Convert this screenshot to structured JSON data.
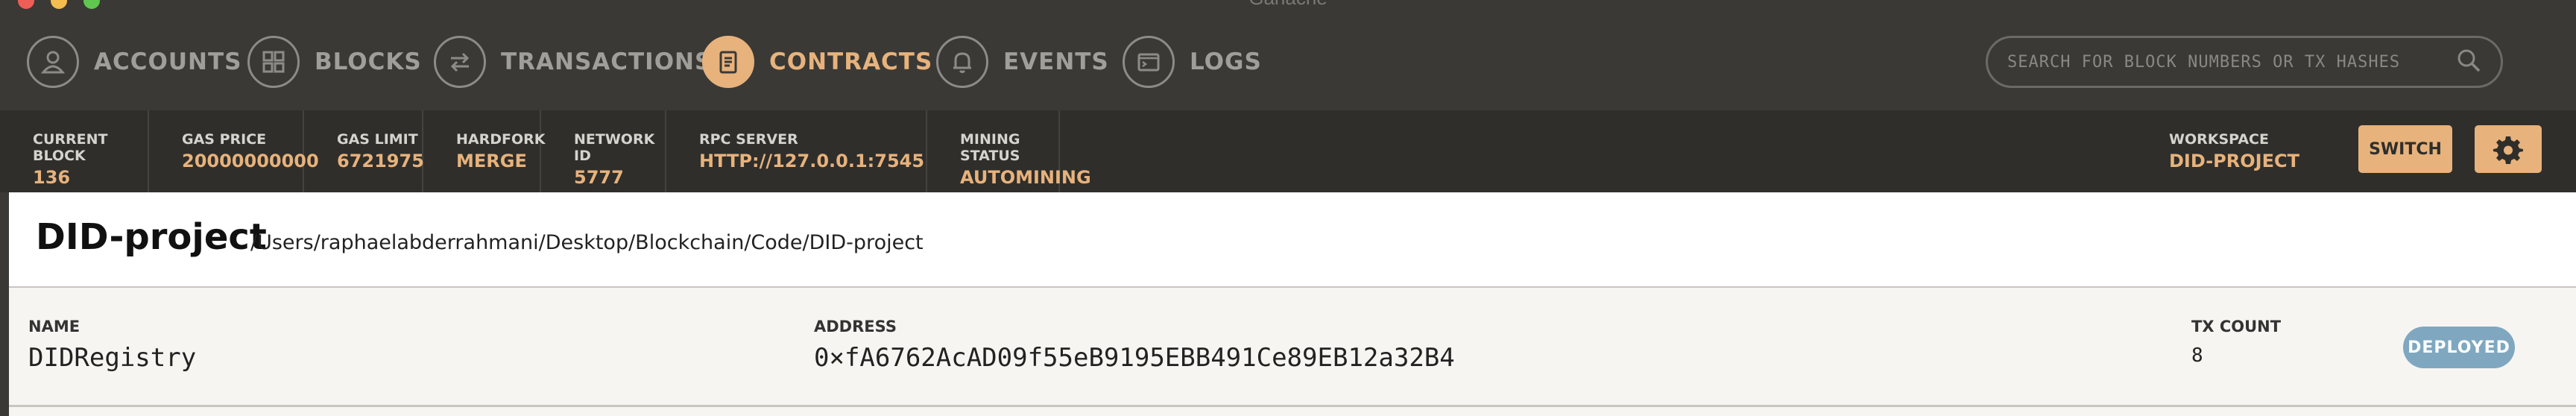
{
  "window": {
    "title": "Ganache"
  },
  "nav": {
    "items": [
      {
        "label": "ACCOUNTS",
        "icon": "account-icon",
        "active": false
      },
      {
        "label": "BLOCKS",
        "icon": "blocks-icon",
        "active": false
      },
      {
        "label": "TRANSACTIONS",
        "icon": "transactions-icon",
        "active": false
      },
      {
        "label": "CONTRACTS",
        "icon": "contracts-icon",
        "active": true
      },
      {
        "label": "EVENTS",
        "icon": "bell-icon",
        "active": false
      },
      {
        "label": "LOGS",
        "icon": "terminal-icon",
        "active": false
      }
    ],
    "search_placeholder": "SEARCH FOR BLOCK NUMBERS OR TX HASHES"
  },
  "status": {
    "current_block": {
      "label": "CURRENT BLOCK",
      "value": "136"
    },
    "gas_price": {
      "label": "GAS PRICE",
      "value": "20000000000"
    },
    "gas_limit": {
      "label": "GAS LIMIT",
      "value": "6721975"
    },
    "hardfork": {
      "label": "HARDFORK",
      "value": "MERGE"
    },
    "network_id": {
      "label": "NETWORK ID",
      "value": "5777"
    },
    "rpc_server": {
      "label": "RPC SERVER",
      "value": "HTTP://127.0.0.1:7545"
    },
    "mining_status": {
      "label": "MINING STATUS",
      "value": "AUTOMINING"
    },
    "workspace": {
      "label": "WORKSPACE",
      "value": "DID-PROJECT"
    },
    "switch_label": "SWITCH"
  },
  "project": {
    "name": "DID-project",
    "path": "/Users/raphaelabderrahmani/Desktop/Blockchain/Code/DID-project"
  },
  "contract": {
    "name_label": "NAME",
    "name": "DIDRegistry",
    "address_label": "ADDRESS",
    "address": "0×fA6762AcAD09f55eB9195EBB491Ce89EB12a32B4",
    "txcount_label": "TX COUNT",
    "txcount": "8",
    "status": "DEPLOYED"
  },
  "colors": {
    "accent": "#e7b27c",
    "nav_bg": "#3a3936",
    "status_bg": "#2f2e2b",
    "badge": "#7fa8c0"
  }
}
